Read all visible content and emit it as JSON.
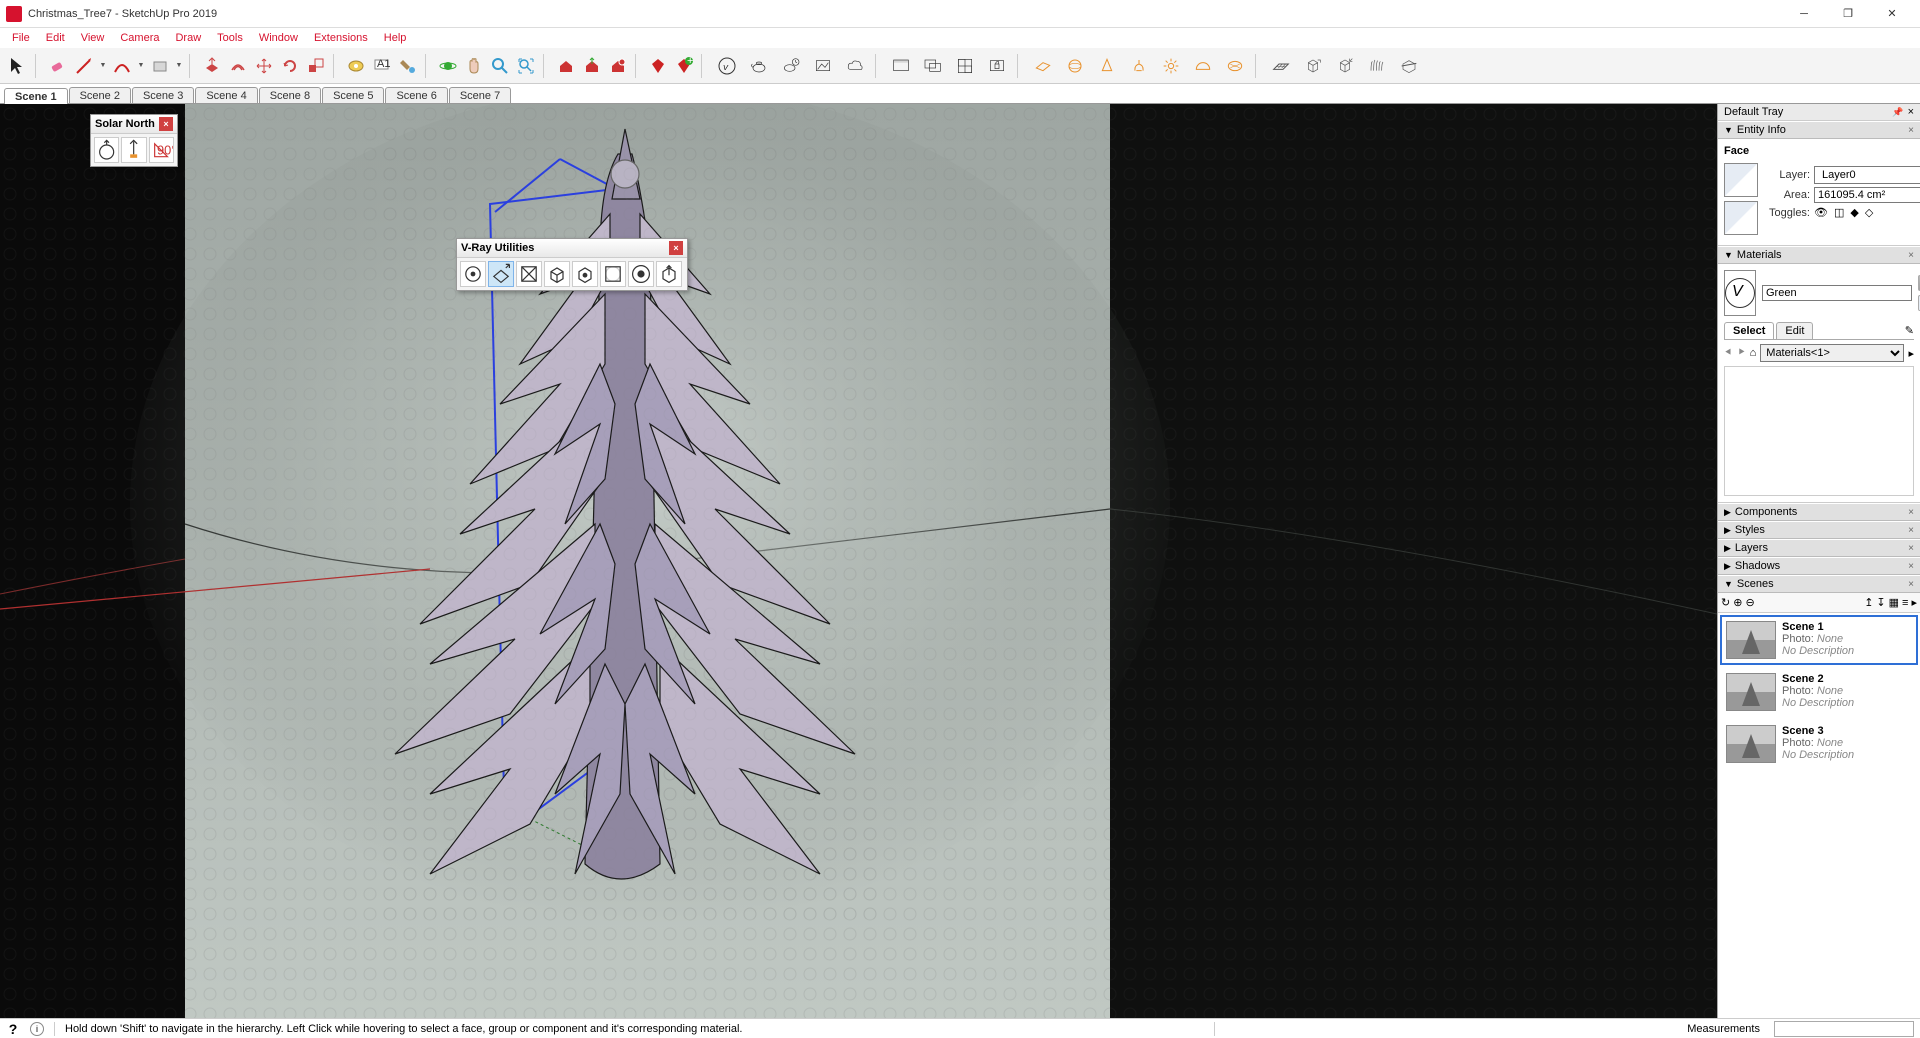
{
  "app": {
    "title": "Christmas_Tree7 - SketchUp Pro 2019"
  },
  "menus": [
    "File",
    "Edit",
    "View",
    "Camera",
    "Draw",
    "Tools",
    "Window",
    "Extensions",
    "Help"
  ],
  "scene_tabs": [
    "Scene 1",
    "Scene 2",
    "Scene 3",
    "Scene 4",
    "Scene 8",
    "Scene 5",
    "Scene 6",
    "Scene 7"
  ],
  "active_scene_tab": 0,
  "float_solar": {
    "title": "Solar North"
  },
  "float_vray": {
    "title": "V-Ray Utilities"
  },
  "tray": {
    "title": "Default Tray",
    "entity_info": {
      "title": "Entity Info",
      "type": "Face",
      "layer_label": "Layer:",
      "layer_value": "Layer0",
      "area_label": "Area:",
      "area_value": "161095.4 cm²",
      "toggles_label": "Toggles:"
    },
    "materials": {
      "title": "Materials",
      "name": "Green",
      "tab_select": "Select",
      "tab_edit": "Edit",
      "library": "Materials<1>"
    },
    "collapsed_panels": [
      "Components",
      "Styles",
      "Layers",
      "Shadows"
    ],
    "scenes_panel": {
      "title": "Scenes",
      "items": [
        {
          "name": "Scene 1",
          "photo_label": "Photo:",
          "photo_value": "None",
          "desc": "No Description",
          "selected": true
        },
        {
          "name": "Scene 2",
          "photo_label": "Photo:",
          "photo_value": "None",
          "desc": "No Description",
          "selected": false
        },
        {
          "name": "Scene 3",
          "photo_label": "Photo:",
          "photo_value": "None",
          "desc": "No Description",
          "selected": false
        }
      ]
    }
  },
  "statusbar": {
    "hint": "Hold down 'Shift' to navigate in the hierarchy. Left Click while hovering to select a face, group or component and it's corresponding material.",
    "measurements_label": "Measurements"
  }
}
